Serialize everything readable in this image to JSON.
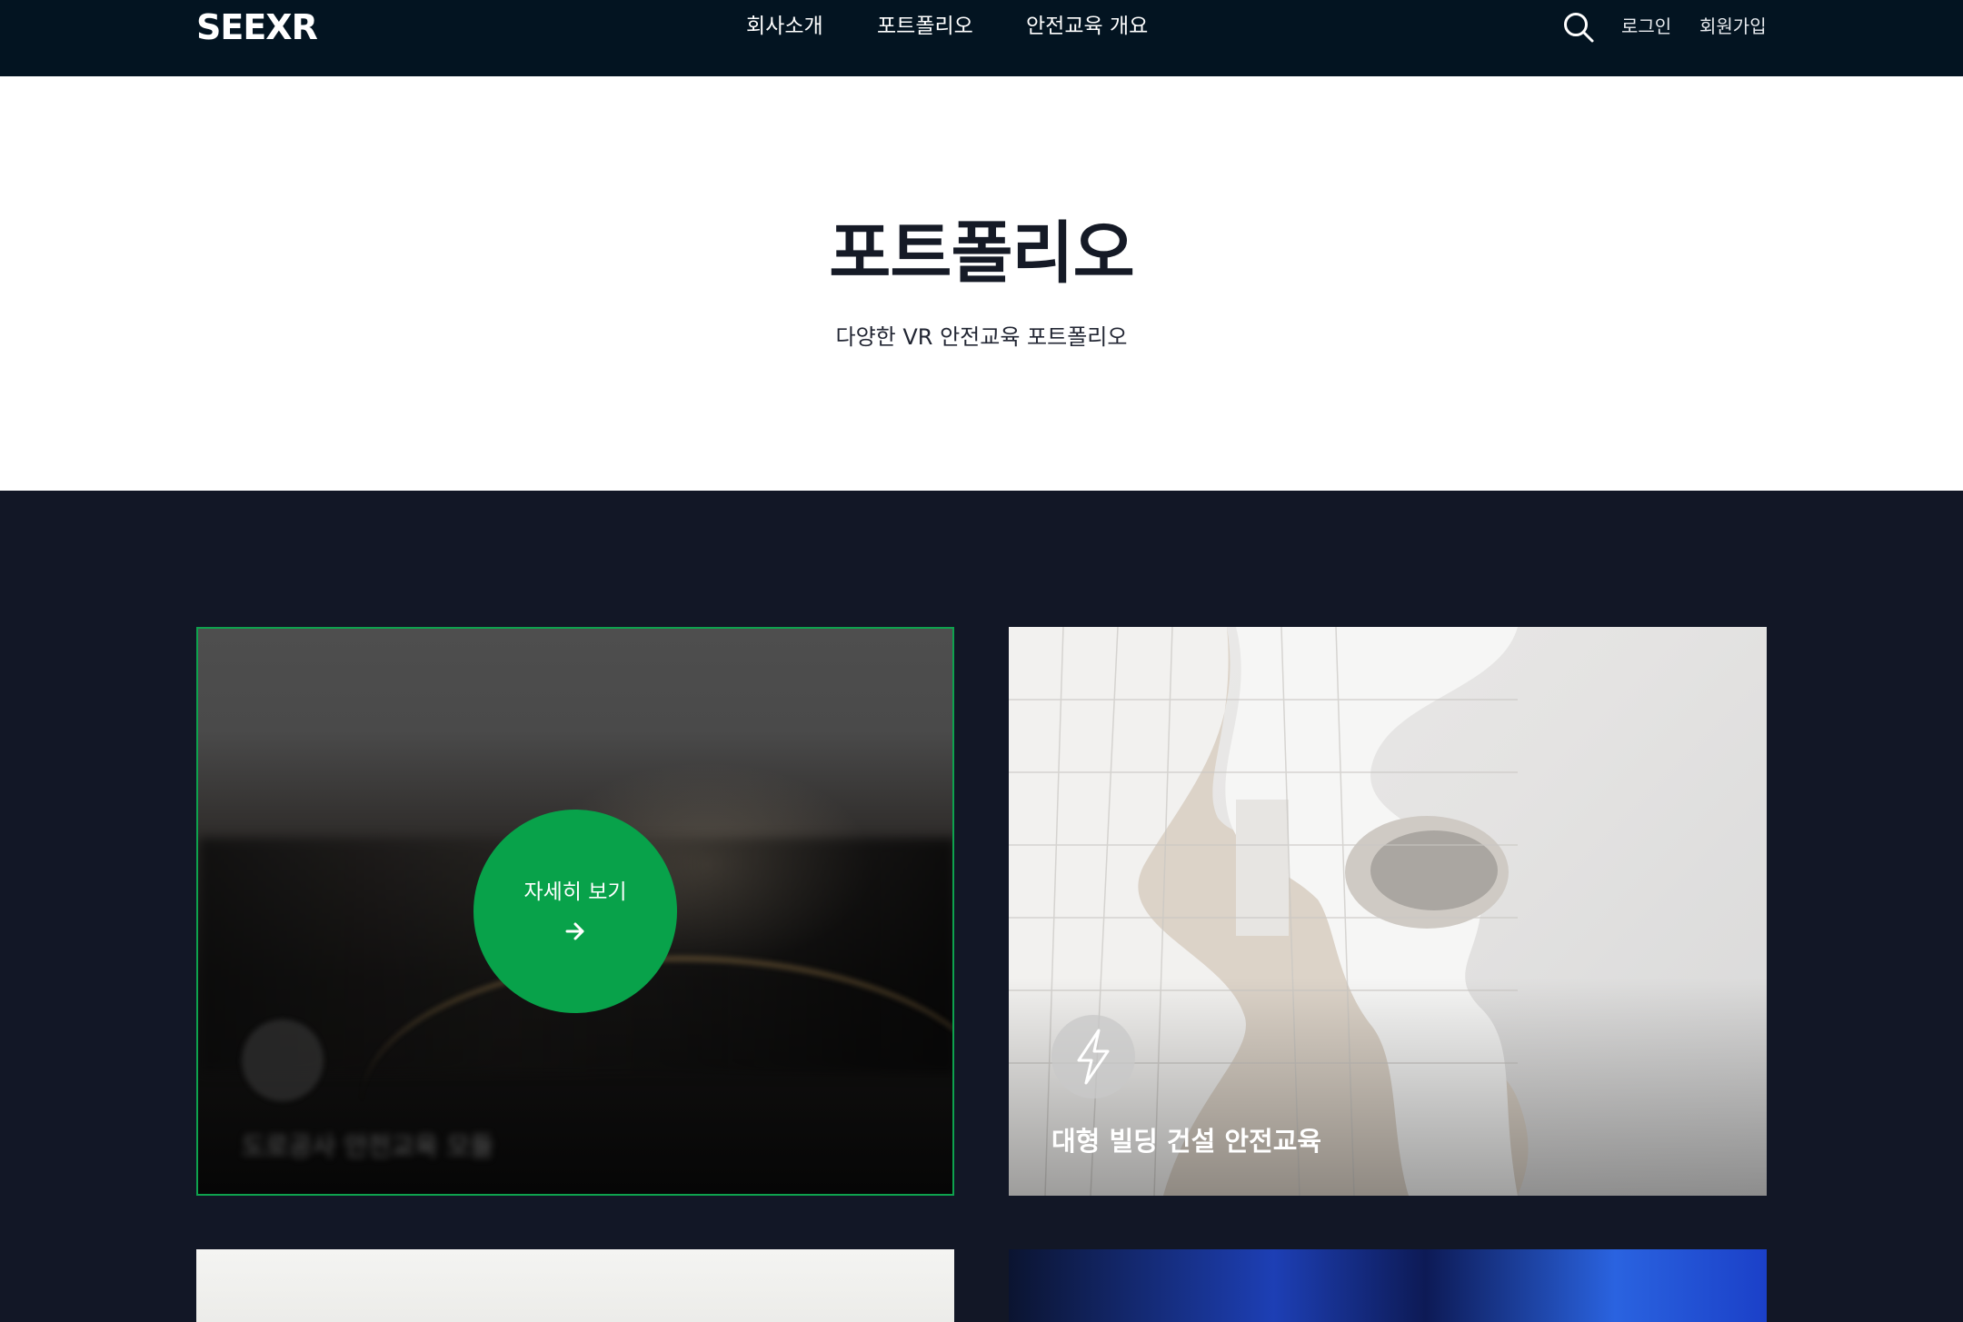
{
  "header": {
    "logo": "SEEXR",
    "nav": [
      {
        "label": "회사소개"
      },
      {
        "label": "포트폴리오"
      },
      {
        "label": "안전교육 개요"
      }
    ],
    "search_icon": "search-icon",
    "login_label": "로그인",
    "signup_label": "회원가입"
  },
  "hero": {
    "title": "포트폴리오",
    "subtitle": "다양한 VR 안전교육 포트폴리오"
  },
  "cards": [
    {
      "title": "도로공사 안전교육 모듈",
      "hover_button_label": "자세히 보기",
      "hover_icon": "arrow-right-icon",
      "accent_color": "#08a24a"
    },
    {
      "title": "대형 빌딩 건설 안전교육",
      "icon": "lightning-bolt-icon"
    }
  ],
  "colors": {
    "topbar": "#031421",
    "page_background": "#121726",
    "accent": "#08a24a"
  }
}
